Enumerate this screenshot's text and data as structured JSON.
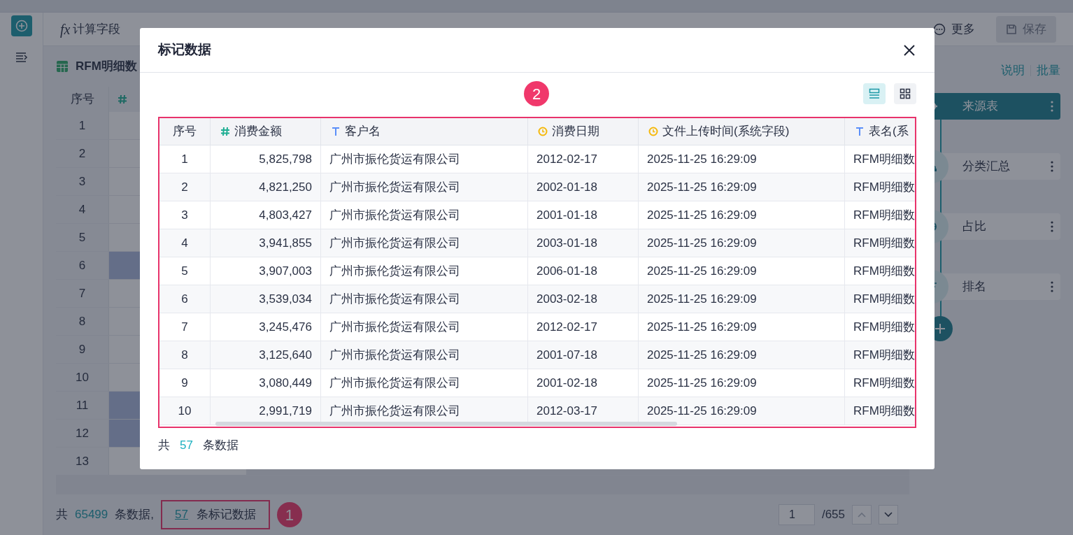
{
  "toolbar": {
    "items": [
      {
        "icon_text": "fx",
        "label": "计算字段"
      }
    ],
    "right_items": [
      {
        "kind": "more",
        "label": "更多"
      }
    ],
    "save": {
      "label": "保存",
      "disabled": true
    }
  },
  "table_title": "RFM明细数",
  "background_table": {
    "columns": [
      "序号"
    ],
    "rows": [
      {
        "index": "1",
        "marked": false
      },
      {
        "index": "2",
        "marked": false
      },
      {
        "index": "3",
        "marked": false
      },
      {
        "index": "4",
        "marked": false
      },
      {
        "index": "5",
        "marked": false
      },
      {
        "index": "6",
        "marked": true
      },
      {
        "index": "7",
        "marked": false
      },
      {
        "index": "8",
        "marked": false
      },
      {
        "index": "9",
        "marked": false
      },
      {
        "index": "10",
        "marked": false
      },
      {
        "index": "11",
        "marked": true
      },
      {
        "index": "12",
        "marked": true
      },
      {
        "index": "13",
        "marked": false
      }
    ]
  },
  "footer": {
    "prefix": "共",
    "total": "65499",
    "middle": "条数据,",
    "marked_count": "57",
    "marked_label": "条标记数据",
    "page": "1",
    "pages": "/655"
  },
  "right_panel": {
    "links": [
      "说明",
      "批量"
    ],
    "steps": [
      {
        "kind": "source",
        "label": "来源表",
        "selected": true
      },
      {
        "kind": "group",
        "label": "分类汇总",
        "selected": false
      },
      {
        "kind": "ratio",
        "label": "占比",
        "selected": false
      },
      {
        "kind": "rank",
        "label": "排名",
        "selected": false
      }
    ]
  },
  "dialog": {
    "title": "标记数据",
    "view_modes": [
      {
        "kind": "list",
        "selected": true
      },
      {
        "kind": "grid",
        "selected": false
      }
    ],
    "columns": [
      {
        "label": "序号",
        "kind": "index"
      },
      {
        "label": "消费金额",
        "kind": "number"
      },
      {
        "label": "客户名",
        "kind": "text"
      },
      {
        "label": "消费日期",
        "kind": "date"
      },
      {
        "label": "文件上传时间(系统字段)",
        "kind": "date"
      },
      {
        "label": "表名(系",
        "kind": "text"
      }
    ],
    "rows": [
      [
        "1",
        "5,825,798",
        "广州市振伦货运有限公司",
        "2012-02-17",
        "2025-11-25 16:29:09",
        "RFM明细数"
      ],
      [
        "2",
        "4,821,250",
        "广州市振伦货运有限公司",
        "2002-01-18",
        "2025-11-25 16:29:09",
        "RFM明细数"
      ],
      [
        "3",
        "4,803,427",
        "广州市振伦货运有限公司",
        "2001-01-18",
        "2025-11-25 16:29:09",
        "RFM明细数"
      ],
      [
        "4",
        "3,941,855",
        "广州市振伦货运有限公司",
        "2003-01-18",
        "2025-11-25 16:29:09",
        "RFM明细数"
      ],
      [
        "5",
        "3,907,003",
        "广州市振伦货运有限公司",
        "2006-01-18",
        "2025-11-25 16:29:09",
        "RFM明细数"
      ],
      [
        "6",
        "3,539,034",
        "广州市振伦货运有限公司",
        "2003-02-18",
        "2025-11-25 16:29:09",
        "RFM明细数"
      ],
      [
        "7",
        "3,245,476",
        "广州市振伦货运有限公司",
        "2012-02-17",
        "2025-11-25 16:29:09",
        "RFM明细数"
      ],
      [
        "8",
        "3,125,640",
        "广州市振伦货运有限公司",
        "2001-07-18",
        "2025-11-25 16:29:09",
        "RFM明细数"
      ],
      [
        "9",
        "3,080,449",
        "广州市振伦货运有限公司",
        "2001-02-18",
        "2025-11-25 16:29:09",
        "RFM明细数"
      ],
      [
        "10",
        "2,991,719",
        "广州市振伦货运有限公司",
        "2012-03-17",
        "2025-11-25 16:29:09",
        "RFM明细数"
      ]
    ],
    "footer": {
      "prefix": "共",
      "count": "57",
      "suffix": "条数据"
    }
  },
  "annotations": [
    "1",
    "2"
  ]
}
